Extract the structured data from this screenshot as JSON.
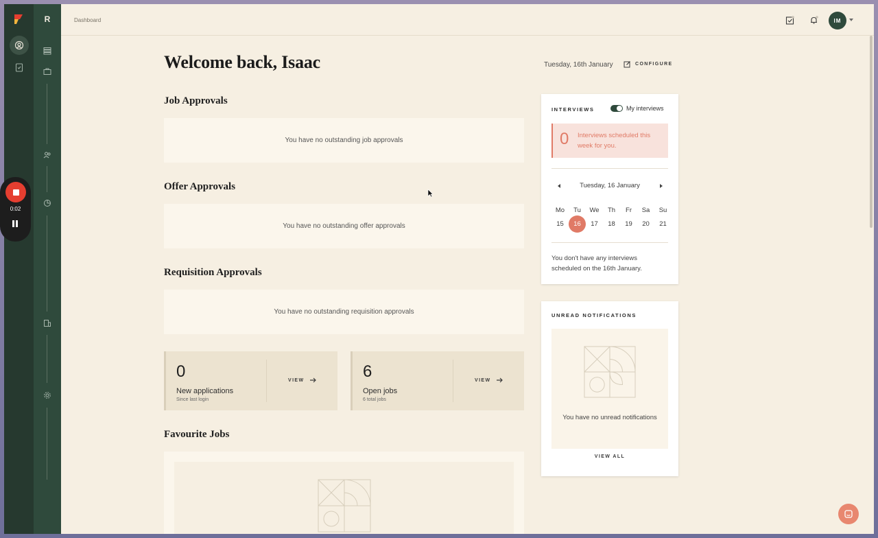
{
  "recorder": {
    "time": "0:02"
  },
  "sidebar": {
    "letter": "R"
  },
  "header": {
    "breadcrumb": "Dashboard",
    "avatar_initials": "IM"
  },
  "main": {
    "welcome": "Welcome back, Isaac",
    "date": "Tuesday, 16th January",
    "configure_label": "CONFIGURE",
    "sections": {
      "job": {
        "title": "Job Approvals",
        "empty": "You have no outstanding job approvals"
      },
      "offer": {
        "title": "Offer Approvals",
        "empty": "You have no outstanding offer approvals"
      },
      "requisition": {
        "title": "Requisition Approvals",
        "empty": "You have no outstanding requisition approvals"
      }
    },
    "stats": [
      {
        "value": "0",
        "label": "New applications",
        "sub": "Since last login",
        "view": "VIEW"
      },
      {
        "value": "6",
        "label": "Open jobs",
        "sub": "6 total jobs",
        "view": "VIEW"
      }
    ],
    "favourites_title": "Favourite Jobs"
  },
  "interviews": {
    "title": "INTERVIEWS",
    "toggle_label": "My interviews",
    "count": "0",
    "count_text": "Interviews scheduled this week for you.",
    "calendar_label": "Tuesday, 16 January",
    "weekdays": [
      "Mo",
      "Tu",
      "We",
      "Th",
      "Fr",
      "Sa",
      "Su"
    ],
    "days": [
      "15",
      "16",
      "17",
      "18",
      "19",
      "20",
      "21"
    ],
    "empty": "You don't have any interviews scheduled on the 16th January."
  },
  "notifications": {
    "title": "UNREAD NOTIFICATIONS",
    "empty": "You have no unread notifications",
    "view_all": "VIEW ALL"
  },
  "colors": {
    "accent": "#e07a66",
    "sidebar": "#2f4a3c",
    "background": "#f6efe2"
  }
}
